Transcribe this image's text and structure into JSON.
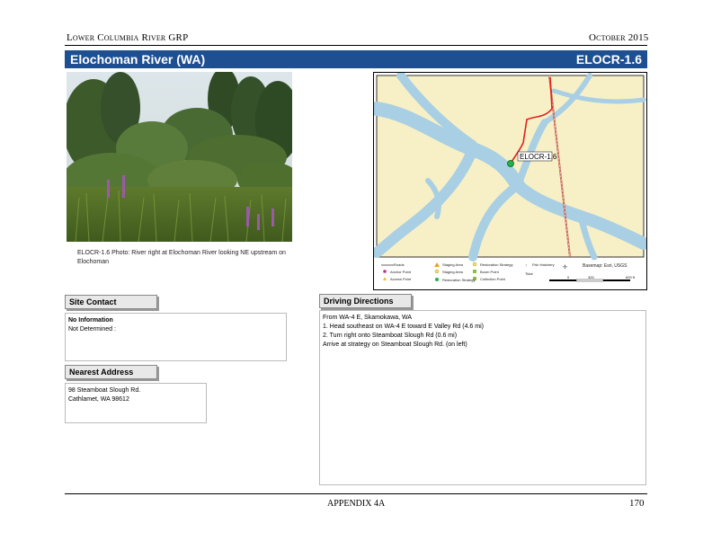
{
  "header": {
    "left": "Lower Columbia River GRP",
    "right": "October 2015"
  },
  "title": {
    "left": "Elochoman River (WA)",
    "right": "ELOCR-1.6"
  },
  "photo": {
    "caption": "ELOCR-1.6 Photo: River right at Elochoman River looking NE upstream on Elochoman"
  },
  "map": {
    "point_label": "ELOCR-1.6",
    "legend": {
      "col1": [
        "Roads",
        "Anchor Point",
        "Access Point"
      ],
      "col2": [
        "Staging Area",
        "Staging Area",
        "Restoration Strategy"
      ],
      "col3": [
        "Restoration Strategy",
        "Boom Point",
        "Collection Point"
      ],
      "col4": [
        "Fish Hatchery",
        "Tidal"
      ],
      "basemap": "Basemap: Esri, USGS"
    },
    "scale": [
      "0",
      "300",
      "600 ft"
    ],
    "colors": {
      "land": "#f7f0c6",
      "water": "#a8cfe3",
      "route": "#e22020",
      "rail": "#c8665a",
      "marker": "#22b14c"
    }
  },
  "site_contact": {
    "label": "Site Contact",
    "line1": "No Information",
    "line2": "Not Determined :"
  },
  "nearest_address": {
    "label": "Nearest Address",
    "line1": "98 Steamboat Slough Rd.",
    "line2": "Cathlamet, WA  98612"
  },
  "driving_directions": {
    "label": "Driving Directions",
    "lines": [
      "From WA-4 E, Skamokawa, WA",
      "1. Head southeast on WA-4 E toward E Valley Rd (4.6 mi)",
      "2. Turn right onto Steamboat Slough Rd (0.6 mi)",
      "Arrive at strategy on Steamboat Slough Rd. (on left)"
    ]
  },
  "footer": {
    "center": "APPENDIX 4A",
    "page": "170"
  }
}
